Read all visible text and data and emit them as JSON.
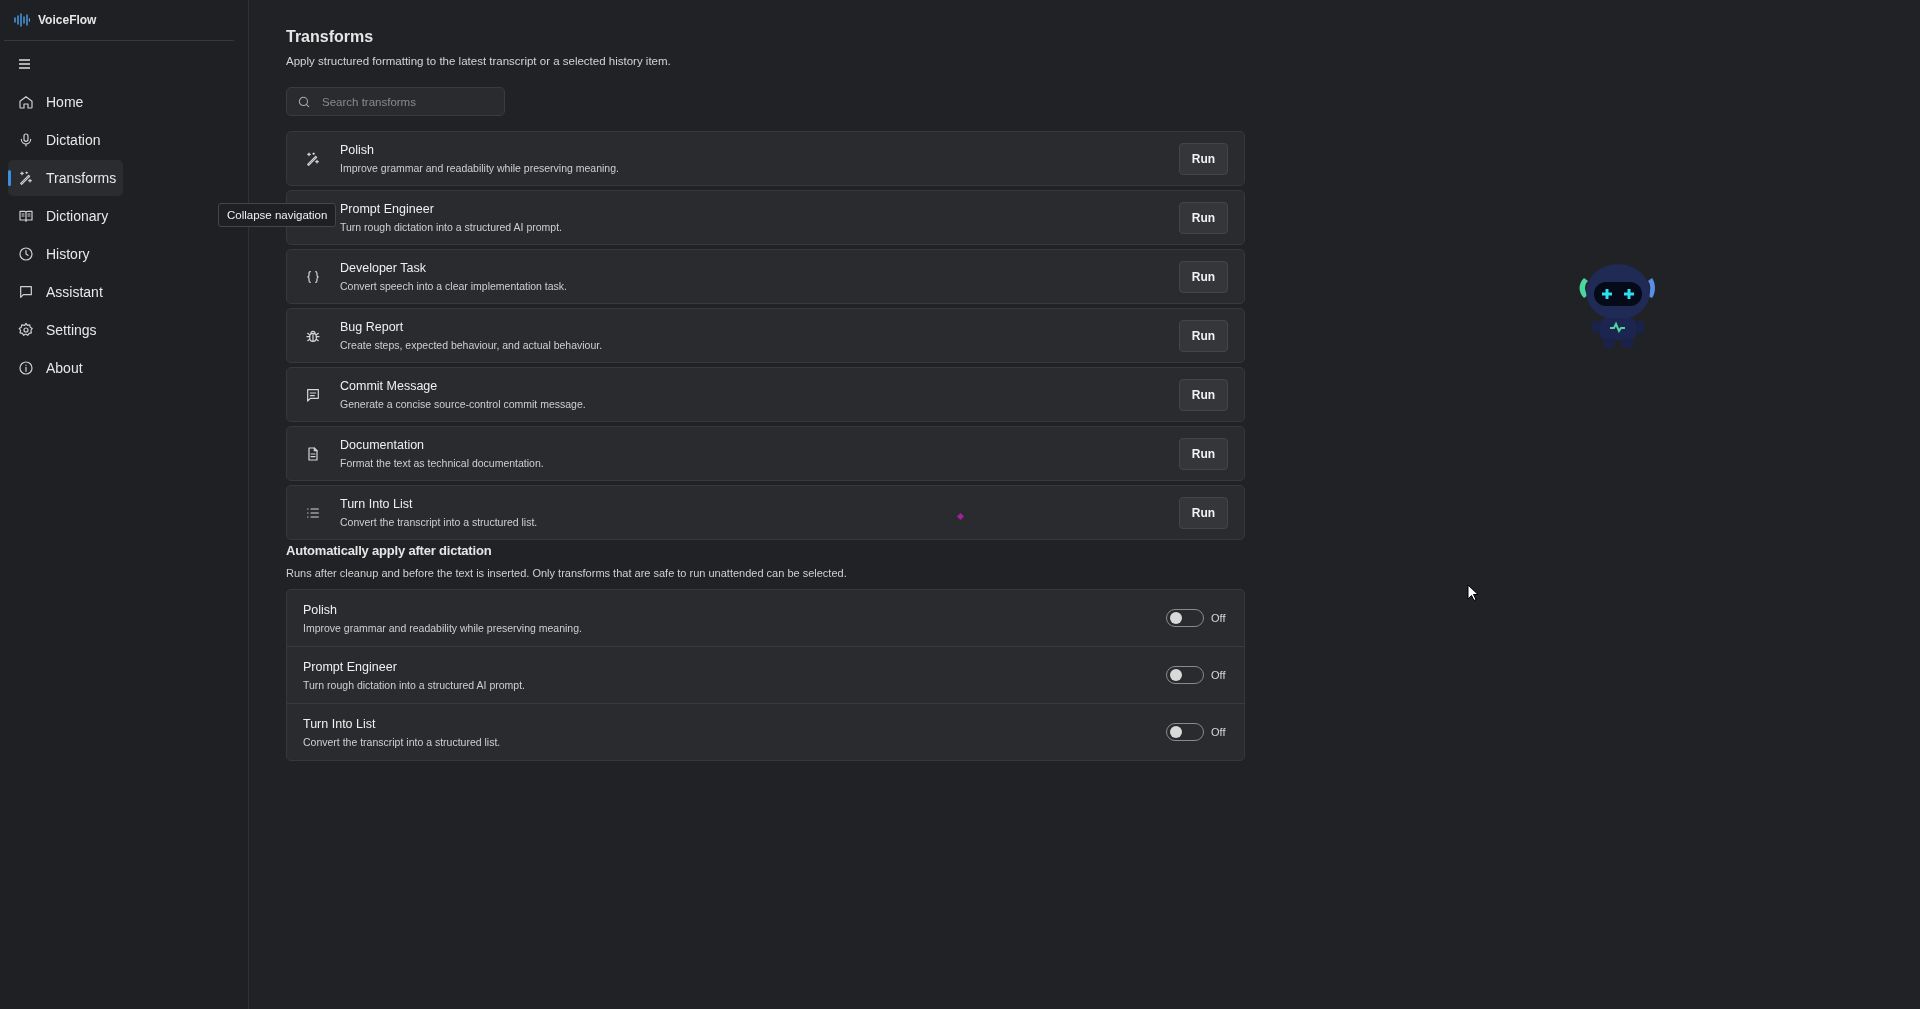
{
  "app": {
    "name": "VoiceFlow"
  },
  "sidebar": {
    "items": [
      {
        "label": "Home",
        "selected": false
      },
      {
        "label": "Dictation",
        "selected": false
      },
      {
        "label": "Transforms",
        "selected": true
      },
      {
        "label": "Dictionary",
        "selected": false
      },
      {
        "label": "History",
        "selected": false
      },
      {
        "label": "Assistant",
        "selected": false
      },
      {
        "label": "Settings",
        "selected": false
      },
      {
        "label": "About",
        "selected": false
      }
    ]
  },
  "tooltip": {
    "text": "Collapse navigation"
  },
  "page": {
    "title": "Transforms",
    "subtitle": "Apply structured formatting to the latest transcript or a selected history item."
  },
  "search": {
    "placeholder": "Search transforms"
  },
  "transforms": [
    {
      "title": "Polish",
      "description": "Improve grammar and readability while preserving meaning.",
      "action": "Run"
    },
    {
      "title": "Prompt Engineer",
      "description": "Turn rough dictation into a structured AI prompt.",
      "action": "Run"
    },
    {
      "title": "Developer Task",
      "description": "Convert speech into a clear implementation task.",
      "action": "Run"
    },
    {
      "title": "Bug Report",
      "description": "Create steps, expected behaviour, and actual behaviour.",
      "action": "Run"
    },
    {
      "title": "Commit Message",
      "description": "Generate a concise source-control commit message.",
      "action": "Run"
    },
    {
      "title": "Documentation",
      "description": "Format the text as technical documentation.",
      "action": "Run"
    },
    {
      "title": "Turn Into List",
      "description": "Convert the transcript into a structured list.",
      "action": "Run"
    }
  ],
  "auto_apply": {
    "title": "Automatically apply after dictation",
    "description": "Runs after cleanup and before the text is inserted. Only transforms that are safe to run unattended can be selected.",
    "items": [
      {
        "title": "Polish",
        "description": "Improve grammar and readability while preserving meaning.",
        "on": false,
        "state_label": "Off"
      },
      {
        "title": "Prompt Engineer",
        "description": "Turn rough dictation into a structured AI prompt.",
        "on": false,
        "state_label": "Off"
      },
      {
        "title": "Turn Into List",
        "description": "Convert the transcript into a structured list.",
        "on": false,
        "state_label": "Off"
      }
    ]
  }
}
